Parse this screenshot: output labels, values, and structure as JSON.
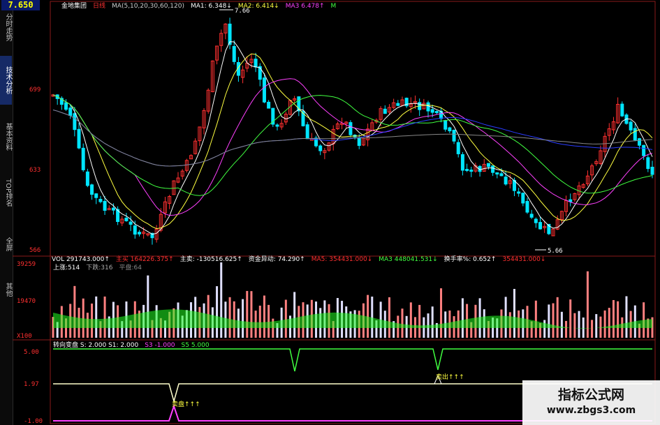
{
  "price_box": "7.650",
  "side_tabs": [
    "分时走势",
    "技术分析",
    "基本资料",
    "TOP排名",
    "全屏",
    "其他"
  ],
  "active_tab": 1,
  "main": {
    "legend": [
      {
        "text": "金地集团",
        "color": "#ffffff"
      },
      {
        "text": "日线",
        "color": "#ff3030"
      },
      {
        "text": "MA(5,10,20,30,60,120)",
        "color": "#cccccc"
      },
      {
        "text": "MA1: 6.348↓",
        "color": "#ffffff"
      },
      {
        "text": "MA2: 6.414↓",
        "color": "#ffff40"
      },
      {
        "text": "MA3 6.478↑",
        "color": "#ff40ff"
      },
      {
        "text": "M",
        "color": "#40ff40"
      }
    ],
    "yticks": [
      "699",
      "633",
      "566"
    ],
    "hi_label": "7.66",
    "lo_label": "5.66"
  },
  "vol": {
    "legend": [
      {
        "text": "VOL 291743.000↑",
        "color": "#ffffff"
      },
      {
        "text": "主买 164226.375↑",
        "color": "#ff3030"
      },
      {
        "text": "主卖: -130516.625↑",
        "color": "#ffffff"
      },
      {
        "text": "资金异动: 74.290↑",
        "color": "#ffffff"
      },
      {
        "text": "MA5: 354431.000↓",
        "color": "#ff3030"
      },
      {
        "text": "MA3 448041.531↓",
        "color": "#40ff40"
      },
      {
        "text": "换手率%: 0.652↑",
        "color": "#ffffff"
      },
      {
        "text": "354431.000↓",
        "color": "#ff3030"
      }
    ],
    "sub": [
      {
        "text": "上涨:514",
        "color": "#ffffff"
      },
      {
        "text": "下跌:316",
        "color": "#aaaaaa"
      },
      {
        "text": "平盘:64",
        "color": "#888888"
      }
    ],
    "yticks": [
      "39259",
      "19470",
      "X100"
    ]
  },
  "ind": {
    "legend": [
      {
        "text": "转向变盘 S: 2.000 S1: 2.000",
        "color": "#ffffff"
      },
      {
        "text": "S3 -1.000",
        "color": "#ff40ff"
      },
      {
        "text": "S5 5.000",
        "color": "#40ff40"
      }
    ],
    "yticks": [
      "5.00",
      "1.97",
      "-1.00"
    ],
    "signal_a": "卖出↑↑↑",
    "signal_b": "卖盘↑↑↑"
  },
  "watermark": {
    "title": "指标公式网",
    "url": "www.zbgs3.com"
  },
  "colors": {
    "up": "#ff3030",
    "down": "#00e5ff",
    "ma1": "#ffffff",
    "ma2": "#ffff40",
    "ma3": "#ff40ff",
    "ma4": "#40ff40",
    "ma5": "#2a3cff",
    "ma6": "#888888"
  },
  "chart_data": {
    "type": "candlestick",
    "ylim": [
      5.66,
      7.66
    ],
    "grid": false
  }
}
